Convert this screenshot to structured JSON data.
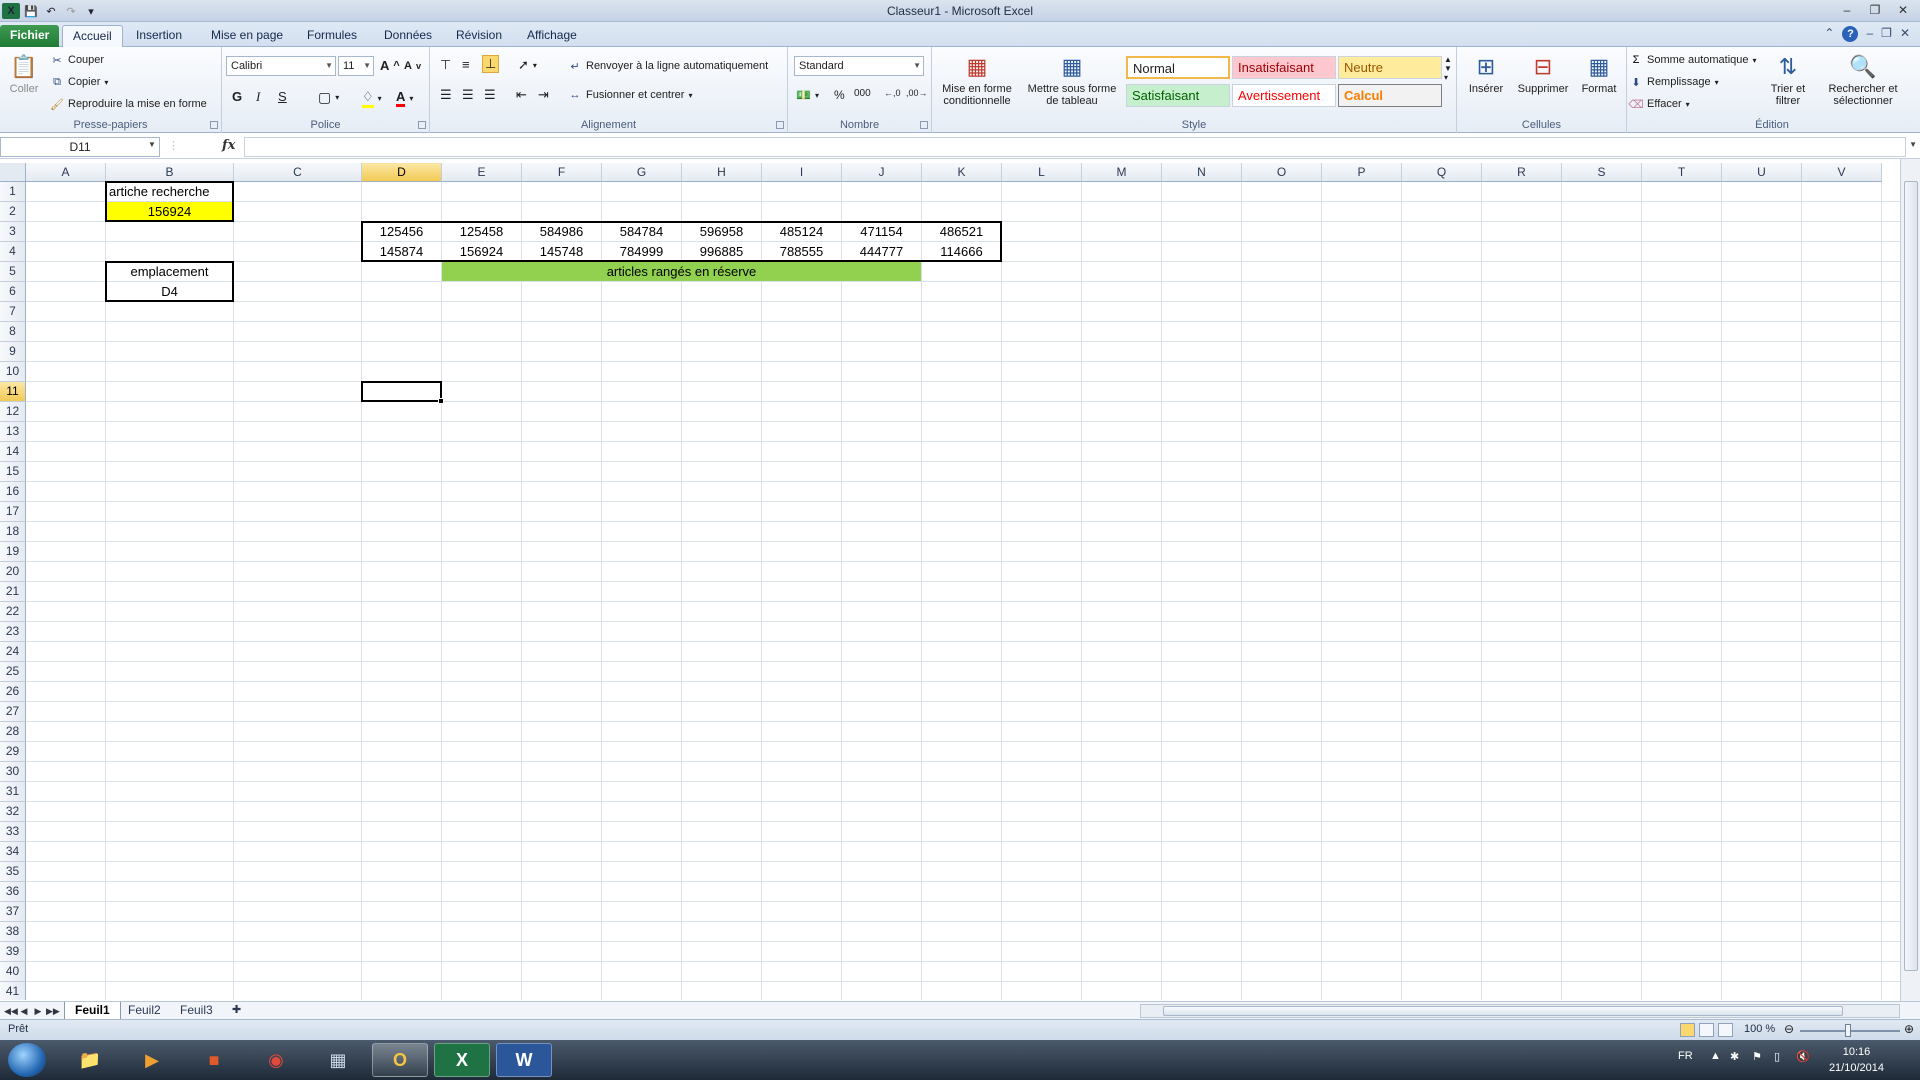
{
  "window": {
    "title": "Classeur1 - Microsoft Excel"
  },
  "tabs": [
    {
      "label": "Fichier"
    },
    {
      "label": "Accueil"
    },
    {
      "label": "Insertion"
    },
    {
      "label": "Mise en page"
    },
    {
      "label": "Formules"
    },
    {
      "label": "Données"
    },
    {
      "label": "Révision"
    },
    {
      "label": "Affichage"
    }
  ],
  "ribbon": {
    "clipboard": {
      "paste": "Coller",
      "cut": "Couper",
      "copy": "Copier",
      "format_painter": "Reproduire la mise en forme",
      "label": "Presse-papiers"
    },
    "font": {
      "name": "Calibri",
      "size": "11",
      "bold": "G",
      "italic": "I",
      "underline": "S",
      "label": "Police"
    },
    "alignment": {
      "wrap": "Renvoyer à la ligne automatiquement",
      "merge": "Fusionner et centrer",
      "label": "Alignement"
    },
    "number": {
      "format": "Standard",
      "label": "Nombre"
    },
    "styles": {
      "conditional": "Mise en forme conditionnelle",
      "as_table": "Mettre sous forme de tableau",
      "normal": "Normal",
      "bad": "Insatisfaisant",
      "neutral": "Neutre",
      "good": "Satisfaisant",
      "warning": "Avertissement",
      "calc": "Calcul",
      "label": "Style"
    },
    "cells": {
      "insert": "Insérer",
      "delete": "Supprimer",
      "format": "Format",
      "label": "Cellules"
    },
    "editing": {
      "autosum": "Somme automatique",
      "fill": "Remplissage",
      "clear": "Effacer",
      "sort": "Trier et filtrer",
      "find": "Rechercher et sélectionner",
      "label": "Édition"
    }
  },
  "formula_bar": {
    "name_box": "D11",
    "fx": "fx",
    "content": ""
  },
  "columns": [
    "A",
    "B",
    "C",
    "D",
    "E",
    "F",
    "G",
    "H",
    "I",
    "J",
    "K",
    "L",
    "M",
    "N",
    "O",
    "P",
    "Q",
    "R",
    "S",
    "T",
    "U",
    "V"
  ],
  "rows": [
    "1",
    "2",
    "3",
    "4",
    "5",
    "6",
    "7",
    "8",
    "9",
    "10",
    "11",
    "12",
    "13",
    "14",
    "15",
    "16",
    "17",
    "18",
    "19",
    "20",
    "21",
    "22",
    "23",
    "24",
    "25",
    "26",
    "27",
    "28",
    "29",
    "30",
    "31",
    "32",
    "33",
    "34",
    "35",
    "36",
    "37",
    "38",
    "39",
    "40",
    "41"
  ],
  "selected_cell": "D11",
  "cells": {
    "B1": "artiche recherche",
    "B2": "156924",
    "B5": "emplacement",
    "B6": "D4",
    "row3": [
      "125456",
      "125458",
      "584986",
      "584784",
      "596958",
      "485124",
      "471154",
      "486521"
    ],
    "row4": [
      "145874",
      "156924",
      "145748",
      "784999",
      "996885",
      "788555",
      "444777",
      "114666"
    ],
    "E5": "articles rangés en réserve"
  },
  "colors": {
    "yellow_fill": "#ffff00",
    "green_fill": "#92d050",
    "selection_header": "#f3ca55"
  },
  "sheets": [
    "Feuil1",
    "Feuil2",
    "Feuil3"
  ],
  "status": {
    "ready": "Prêt",
    "zoom": "100 %"
  },
  "taskbar": {
    "lang": "FR",
    "time": "10:16",
    "date": "21/10/2014"
  }
}
